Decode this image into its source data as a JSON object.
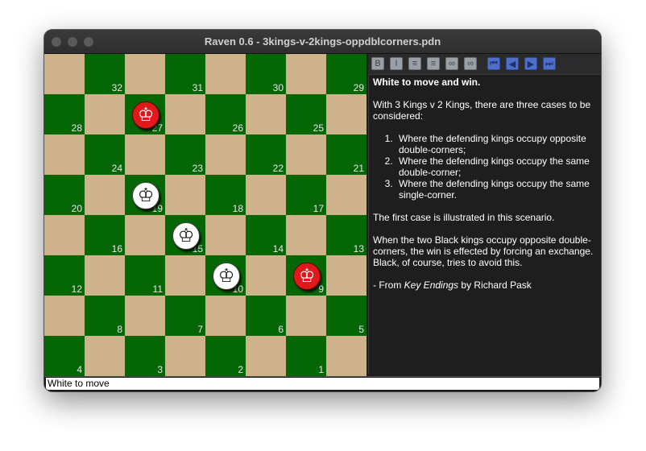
{
  "window": {
    "title": "Raven 0.6 - 3kings-v-2kings-oppdblcorners.pdn"
  },
  "board": {
    "colors": {
      "light": "#cdb28b",
      "dark": "#046604"
    },
    "squares": [
      {
        "row": 0,
        "col": 1,
        "num": "32"
      },
      {
        "row": 0,
        "col": 3,
        "num": "31"
      },
      {
        "row": 0,
        "col": 5,
        "num": "30"
      },
      {
        "row": 0,
        "col": 7,
        "num": "29"
      },
      {
        "row": 1,
        "col": 0,
        "num": "28"
      },
      {
        "row": 1,
        "col": 2,
        "num": "27"
      },
      {
        "row": 1,
        "col": 4,
        "num": "26"
      },
      {
        "row": 1,
        "col": 6,
        "num": "25"
      },
      {
        "row": 2,
        "col": 1,
        "num": "24"
      },
      {
        "row": 2,
        "col": 3,
        "num": "23"
      },
      {
        "row": 2,
        "col": 5,
        "num": "22"
      },
      {
        "row": 2,
        "col": 7,
        "num": "21"
      },
      {
        "row": 3,
        "col": 0,
        "num": "20"
      },
      {
        "row": 3,
        "col": 2,
        "num": "19"
      },
      {
        "row": 3,
        "col": 4,
        "num": "18"
      },
      {
        "row": 3,
        "col": 6,
        "num": "17"
      },
      {
        "row": 4,
        "col": 1,
        "num": "16"
      },
      {
        "row": 4,
        "col": 3,
        "num": "15"
      },
      {
        "row": 4,
        "col": 5,
        "num": "14"
      },
      {
        "row": 4,
        "col": 7,
        "num": "13"
      },
      {
        "row": 5,
        "col": 0,
        "num": "12"
      },
      {
        "row": 5,
        "col": 2,
        "num": "11"
      },
      {
        "row": 5,
        "col": 4,
        "num": "10"
      },
      {
        "row": 5,
        "col": 6,
        "num": "9"
      },
      {
        "row": 6,
        "col": 1,
        "num": "8"
      },
      {
        "row": 6,
        "col": 3,
        "num": "7"
      },
      {
        "row": 6,
        "col": 5,
        "num": "6"
      },
      {
        "row": 6,
        "col": 7,
        "num": "5"
      },
      {
        "row": 7,
        "col": 0,
        "num": "4"
      },
      {
        "row": 7,
        "col": 2,
        "num": "3"
      },
      {
        "row": 7,
        "col": 4,
        "num": "2"
      },
      {
        "row": 7,
        "col": 6,
        "num": "1"
      }
    ],
    "pieces": [
      {
        "square": "27",
        "color": "red",
        "type": "king"
      },
      {
        "square": "19",
        "color": "white",
        "type": "king"
      },
      {
        "square": "15",
        "color": "white",
        "type": "king"
      },
      {
        "square": "10",
        "color": "white",
        "type": "king"
      },
      {
        "square": "9",
        "color": "red",
        "type": "king"
      }
    ]
  },
  "toolbar": {
    "format": [
      {
        "name": "bold-button",
        "icon": "bold-icon",
        "glyph": "B"
      },
      {
        "name": "italic-button",
        "icon": "italic-icon",
        "glyph": "I"
      },
      {
        "name": "bullet-list-button",
        "icon": "bullet-list-icon",
        "glyph": "≡"
      },
      {
        "name": "numbered-list-button",
        "icon": "numbered-list-icon",
        "glyph": "≡"
      },
      {
        "name": "link-button",
        "icon": "link-icon",
        "glyph": "∞"
      },
      {
        "name": "unlink-button",
        "icon": "unlink-icon",
        "glyph": "∞"
      }
    ],
    "navigation": [
      {
        "name": "first-move-button",
        "icon": "skip-first-icon",
        "glyph": "⏮"
      },
      {
        "name": "previous-move-button",
        "icon": "step-back-icon",
        "glyph": "◀"
      },
      {
        "name": "next-move-button",
        "icon": "step-forward-icon",
        "glyph": "▶"
      },
      {
        "name": "last-move-button",
        "icon": "skip-last-icon",
        "glyph": "⏭"
      }
    ]
  },
  "annotation": {
    "heading": "White to move and win.",
    "intro": "With 3 Kings v 2 Kings, there are three cases to be considered:",
    "cases": [
      "Where the defending kings occupy opposite double-corners;",
      "Where the defending kings occupy the same double-corner;",
      "Where the defending kings occupy the same single-corner."
    ],
    "illustrated": "The first case is illustrated in this scenario.",
    "explanation": "When the two Black kings occupy opposite double-corners, the win is effected by forcing an exchange. Black, of course, tries to avoid this.",
    "source_prefix": "- From",
    "source_title": "Key Endings",
    "source_suffix": "by Richard Pask"
  },
  "status": {
    "text": "White to move"
  }
}
